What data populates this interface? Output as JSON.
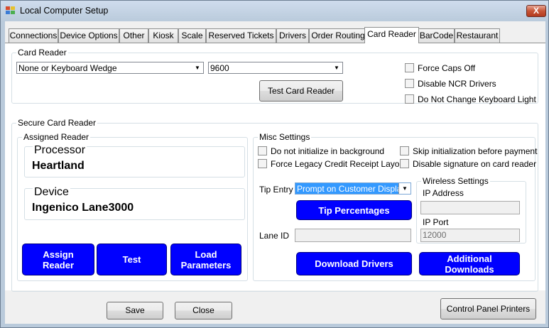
{
  "window": {
    "title": "Local Computer Setup",
    "close_glyph": "X"
  },
  "tabs": [
    {
      "label": "Connections"
    },
    {
      "label": "Device Options"
    },
    {
      "label": "Other"
    },
    {
      "label": "Kiosk"
    },
    {
      "label": "Scale"
    },
    {
      "label": "Reserved Tickets"
    },
    {
      "label": "Drivers"
    },
    {
      "label": "Order Routing"
    },
    {
      "label": "Card Reader"
    },
    {
      "label": "BarCode"
    },
    {
      "label": "Restaurant"
    }
  ],
  "active_tab": "Card Reader",
  "card_reader": {
    "legend": "Card Reader",
    "reader_type": "None or Keyboard Wedge",
    "baud_rate": "9600",
    "test_button": "Test Card Reader",
    "force_caps_off": "Force Caps Off",
    "disable_ncr": "Disable NCR Drivers",
    "no_keyboard_light": "Do Not Change Keyboard Light"
  },
  "secure": {
    "legend": "Secure Card Reader",
    "assigned_legend": "Assigned Reader",
    "processor_label": "Processor",
    "processor_value": "Heartland",
    "device_label": "Device",
    "device_value": "Ingenico Lane3000",
    "assign_button": "Assign Reader",
    "test_button": "Test",
    "load_button": "Load Parameters"
  },
  "misc": {
    "legend": "Misc Settings",
    "no_init_bg": "Do not initialize in background",
    "skip_init": "Skip initialization before payment",
    "force_legacy": "Force Legacy Credit Receipt Layout",
    "disable_sig": "Disable signature on card reader",
    "tip_entry_label": "Tip Entry",
    "tip_entry_value": "Prompt on Customer Display",
    "tip_percentages": "Tip Percentages",
    "lane_id_label": "Lane ID",
    "lane_id_value": "",
    "download_drivers": "Download Drivers",
    "additional_downloads": "Additional Downloads",
    "wireless": {
      "legend": "Wireless Settings",
      "ip_label": "IP Address",
      "ip_value": "",
      "port_label": "IP Port",
      "port_value": "12000"
    }
  },
  "footer": {
    "save": "Save",
    "close": "Close",
    "control_panel": "Control Panel Printers"
  }
}
